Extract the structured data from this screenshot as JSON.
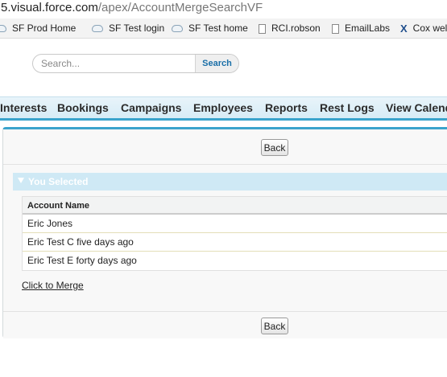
{
  "browser": {
    "url_host": "5.visual.force.com",
    "url_path": "/apex/AccountMergeSearchVF",
    "bookmarks": [
      {
        "label": "SF Prod Home",
        "icon": "cloud-icon"
      },
      {
        "label": "SF Test login",
        "icon": "cloud-icon"
      },
      {
        "label": "SF Test home",
        "icon": "cloud-icon"
      },
      {
        "label": "RCI.robson",
        "icon": "page-icon"
      },
      {
        "label": "EmailLabs",
        "icon": "page-icon"
      },
      {
        "label": "Cox wel",
        "icon": "x-icon"
      }
    ]
  },
  "search": {
    "placeholder": "Search...",
    "button_label": "Search"
  },
  "tabs": [
    "Interests",
    "Bookings",
    "Campaigns",
    "Employees",
    "Reports",
    "Rest Logs",
    "View Calend"
  ],
  "page": {
    "back_label": "Back",
    "section_title": "You Selected",
    "table_header": "Account Name",
    "rows": [
      "Eric Jones",
      "Eric Test C five days ago",
      "Eric Test E forty days ago"
    ],
    "merge_link": "Click to Merge"
  },
  "colors": {
    "accent": "#3aa3cc",
    "section_bar": "#cfe9f5",
    "search_button_text": "#1a6fa8"
  }
}
